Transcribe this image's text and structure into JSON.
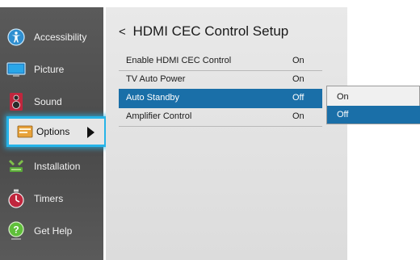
{
  "sidebar": {
    "items": [
      {
        "label": "Accessibility",
        "icon": "accessibility-icon"
      },
      {
        "label": "Picture",
        "icon": "picture-icon"
      },
      {
        "label": "Sound",
        "icon": "speaker-icon"
      },
      {
        "label": "Options",
        "icon": "options-icon",
        "selected": true
      },
      {
        "label": "Installation",
        "icon": "installation-icon"
      },
      {
        "label": "Timers",
        "icon": "timer-icon"
      },
      {
        "label": "Get Help",
        "icon": "help-icon"
      }
    ]
  },
  "main": {
    "back_glyph": "<",
    "title": "HDMI CEC Control Setup",
    "rows": [
      {
        "label": "Enable HDMI CEC Control",
        "value": "On"
      },
      {
        "label": "TV Auto Power",
        "value": "On"
      },
      {
        "label": "Auto Standby",
        "value": "Off",
        "selected": true
      },
      {
        "label": "Amplifier Control",
        "value": "On"
      }
    ]
  },
  "popup": {
    "options": [
      {
        "label": "On"
      },
      {
        "label": "Off",
        "selected": true
      }
    ]
  },
  "colors": {
    "accent_highlight": "#26b4e8",
    "selection_blue": "#1a6fa8",
    "sidebar_bg": "#4a4a4a",
    "panel_bg": "#e2e2e2"
  }
}
